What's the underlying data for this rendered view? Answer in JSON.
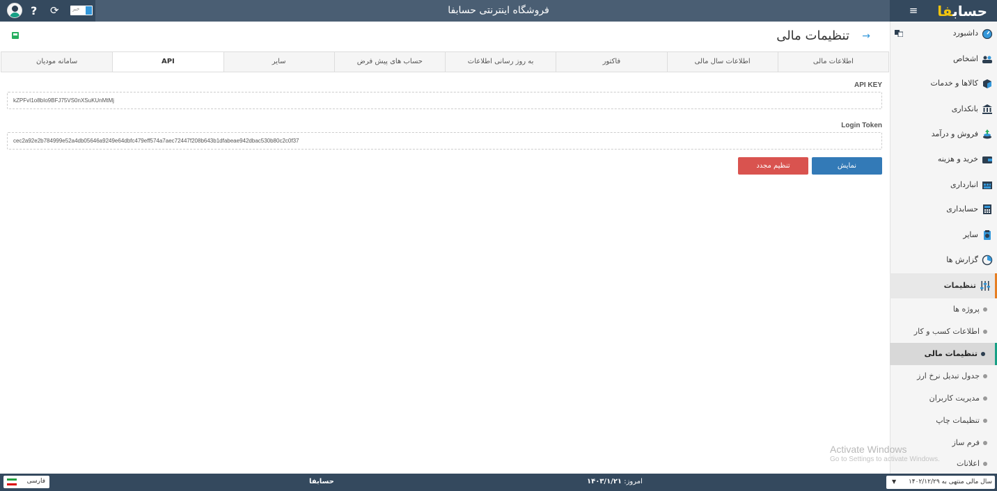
{
  "topbar": {
    "title": "فروشگاه اینترنتی حسابفا",
    "logo_main": "حساب",
    "logo_accent": "فا",
    "news_label": "خبر"
  },
  "sidebar": {
    "items": [
      {
        "label": "داشبورد",
        "icon": "dashboard-icon"
      },
      {
        "label": "اشخاص",
        "icon": "people-icon"
      },
      {
        "label": "کالاها و خدمات",
        "icon": "box-icon"
      },
      {
        "label": "بانکداری",
        "icon": "bank-icon"
      },
      {
        "label": "فروش و درآمد",
        "icon": "sales-icon"
      },
      {
        "label": "خرید و هزینه",
        "icon": "wallet-icon"
      },
      {
        "label": "انبارداری",
        "icon": "warehouse-icon"
      },
      {
        "label": "حسابداری",
        "icon": "accounting-icon"
      },
      {
        "label": "سایر",
        "icon": "other-icon"
      },
      {
        "label": "گزارش ها",
        "icon": "reports-icon"
      },
      {
        "label": "تنظیمات",
        "icon": "settings-sliders-icon"
      }
    ],
    "sub_items": [
      {
        "label": "پروژه ها"
      },
      {
        "label": "اطلاعات کسب و کار"
      },
      {
        "label": "تنظیمات مالی"
      },
      {
        "label": "جدول تبدیل نرخ ارز"
      },
      {
        "label": "مدیریت کاربران"
      },
      {
        "label": "تنظیمات چاپ"
      },
      {
        "label": "فرم ساز"
      },
      {
        "label": "اعلانات"
      }
    ]
  },
  "page": {
    "title": "تنظیمات مالی"
  },
  "tabs": [
    {
      "label": "اطلاعات مالی"
    },
    {
      "label": "اطلاعات سال مالی"
    },
    {
      "label": "فاکتور"
    },
    {
      "label": "به روز رسانی اطلاعات"
    },
    {
      "label": "حساب های پیش فرض"
    },
    {
      "label": "سایر"
    },
    {
      "label": "API"
    },
    {
      "label": "سامانه مودیان"
    }
  ],
  "api": {
    "api_key_label": "API KEY",
    "api_key_value": "kZPFvI1o8bIo9BFJ75VS0nXSuKUnMtMj",
    "login_token_label": "Login Token",
    "login_token_value": "cec2a92e2b784999e52a4db05646a9249e64dbfc479eff574a7aec72447f208b643b1dfabeae942dbac530b80c2c0f37",
    "show_button": "نمایش",
    "reset_button": "تنظیم مجدد"
  },
  "watermark": {
    "line1": "Activate Windows",
    "line2": "Go to Settings to activate Windows."
  },
  "footer": {
    "language": "فارسی",
    "brand": "حسابفا",
    "today_label": "امروز:",
    "today_value": "۱۴۰۳/۱/۲۱",
    "fiscal_year": "سال مالی منتهی به ۱۴۰۲/۱۲/۲۹"
  },
  "colors": {
    "topbar": "#4a5e73",
    "dark": "#34495e",
    "primary_button": "#337ab7",
    "danger_button": "#d9534f",
    "settings_accent": "#e67e22",
    "sub_active_accent": "#16a085"
  }
}
